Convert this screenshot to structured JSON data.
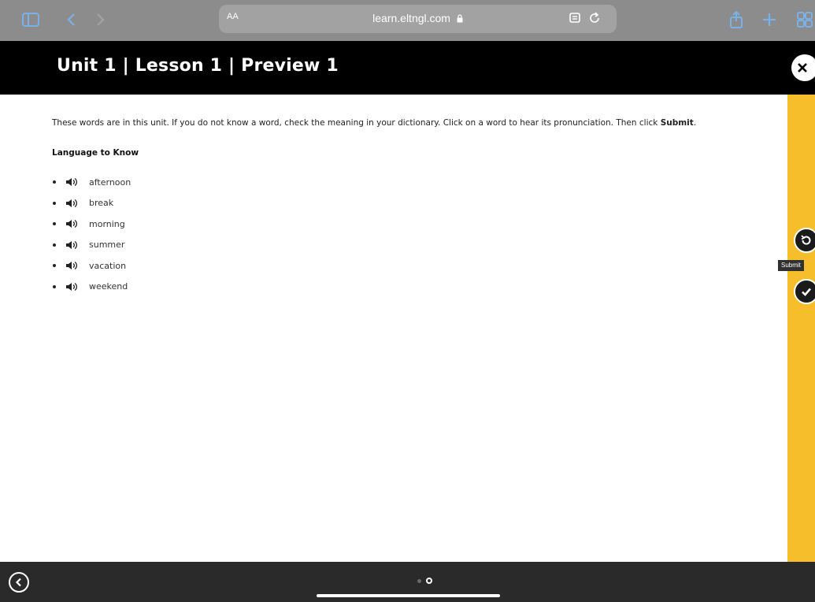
{
  "browser": {
    "text_size_label": "AA",
    "url": "learn.eltngl.com"
  },
  "header": {
    "title": "Unit 1 | Lesson 1 | Preview 1"
  },
  "content": {
    "instructions_text": "These words are in this unit. If you do not know a word, check the meaning in your dictionary. Click on a word to hear its pronunciation. Then click ",
    "instructions_bold": "Submit",
    "instructions_end": ".",
    "section_heading": "Language to Know",
    "words": [
      "afternoon",
      "break",
      "morning",
      "summer",
      "vacation",
      "weekend"
    ]
  },
  "side_rail": {
    "submit_tooltip": "Submit",
    "accent_color": "#f5be2a"
  },
  "pager": {
    "total": 2,
    "current": 2
  },
  "icons": {
    "sidebar": "sidebar-icon",
    "back": "chevron-left-icon",
    "forward": "chevron-right-icon",
    "lock": "lock-icon",
    "reader": "reader-icon",
    "reload": "reload-icon",
    "share": "share-icon",
    "add": "plus-icon",
    "tabs": "tabs-icon",
    "close": "close-icon",
    "speaker": "speaker-icon",
    "reset": "reset-icon",
    "submit": "checkmark-icon"
  }
}
